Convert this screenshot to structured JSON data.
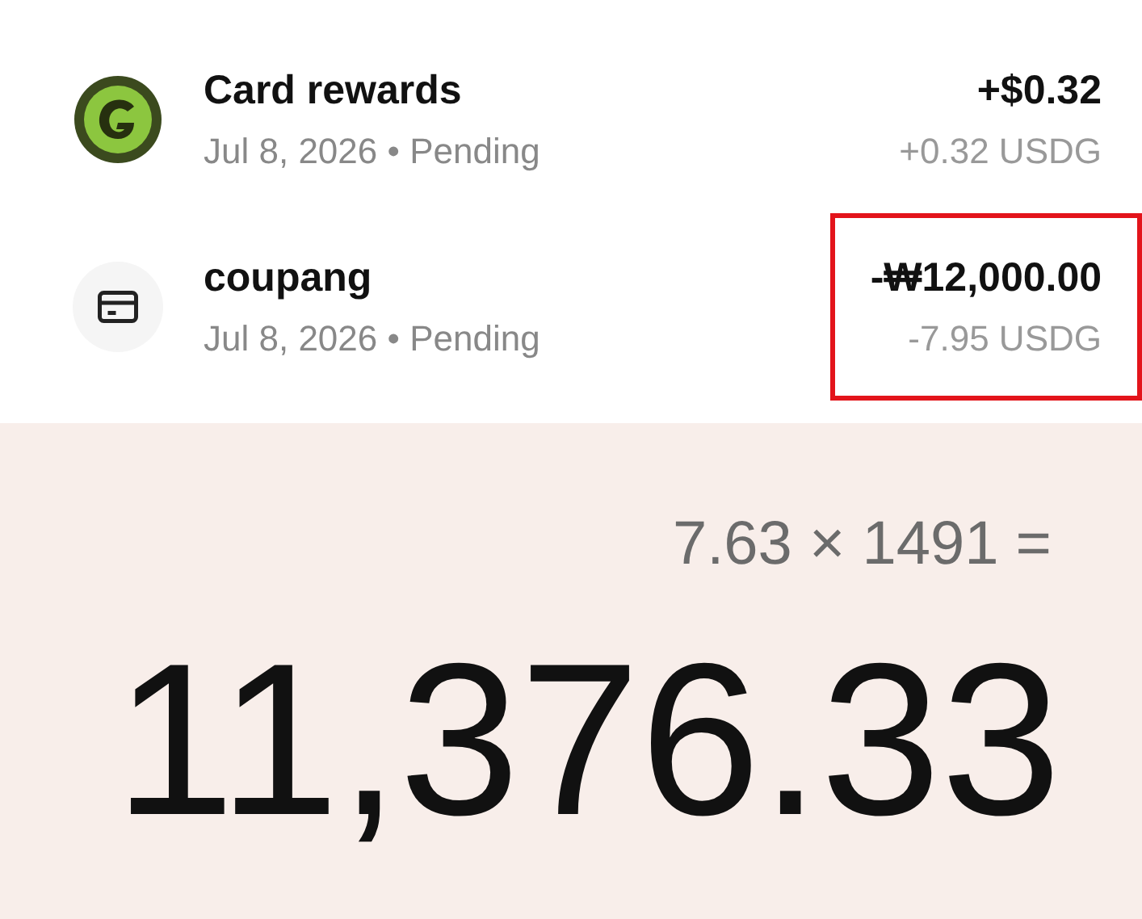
{
  "transactions": [
    {
      "kind": "rewards",
      "name": "Card rewards",
      "subtitle": "Jul 8, 2026 • Pending",
      "amount": "+$0.32",
      "amount_usdg": "+0.32 USDG",
      "highlighted": false
    },
    {
      "kind": "card",
      "name": "coupang",
      "subtitle": "Jul 8, 2026 • Pending",
      "amount": "-₩12,000.00",
      "amount_usdg": "-7.95 USDG",
      "highlighted": true
    }
  ],
  "calculator": {
    "expression": "7.63 × 1491 =",
    "result": "11,376.33"
  }
}
